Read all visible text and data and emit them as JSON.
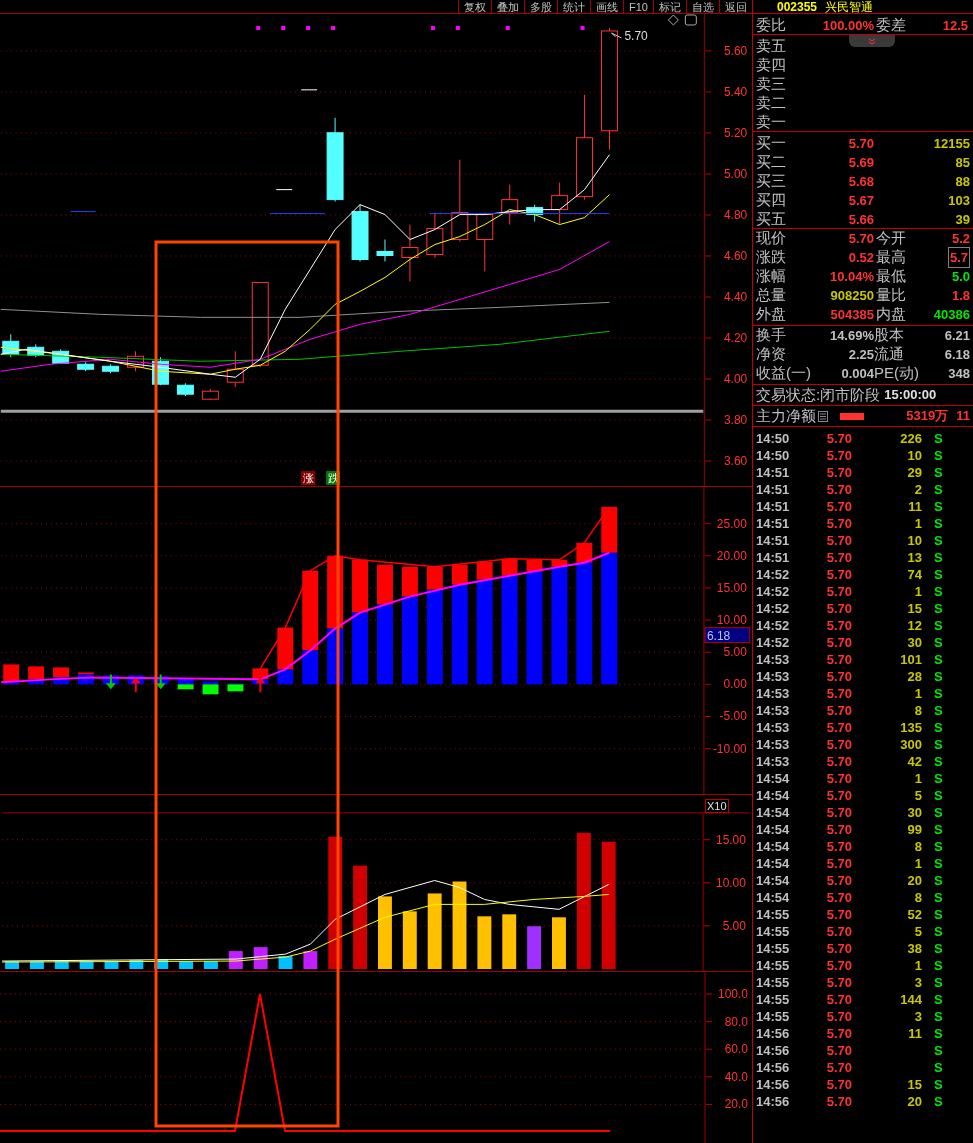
{
  "toolbar": {
    "buttons": [
      "复权",
      "叠加",
      "多股",
      "统计",
      "画线",
      "F10",
      "标记",
      "自选",
      "返回"
    ]
  },
  "price_chart": {
    "price_tag": "5.70",
    "yticks": [
      "5.60",
      "5.40",
      "5.20",
      "5.00",
      "4.80",
      "4.60",
      "4.40",
      "4.20",
      "4.00",
      "3.80",
      "3.60"
    ],
    "markers": [
      {
        "label": "涨",
        "color": "#8b0000"
      },
      {
        "label": "跌",
        "color": "#007a00"
      }
    ]
  },
  "indicator_chart": {
    "yticks": [
      "25.00",
      "20.00",
      "15.00",
      "10.00",
      "5.00",
      "0.00",
      "-5.00",
      "-10.00"
    ],
    "value_badge": "6.18"
  },
  "volume_chart": {
    "multiplier": "X10",
    "yticks": [
      "15.00",
      "10.00",
      "5.00"
    ]
  },
  "oscillator_chart": {
    "yticks": [
      "100.0",
      "80.0",
      "60.0",
      "40.0",
      "20.0"
    ]
  },
  "quote": {
    "code": "002355",
    "name": "兴民智通",
    "commission": [
      {
        "label": "委比",
        "value": "100.00%"
      },
      {
        "label": "委差",
        "value": "12.5"
      }
    ],
    "sell": [
      {
        "label": "卖五"
      },
      {
        "label": "卖四"
      },
      {
        "label": "卖三"
      },
      {
        "label": "卖二"
      },
      {
        "label": "卖一"
      }
    ],
    "buy": [
      {
        "label": "买一",
        "price": "5.70",
        "volume": "12155"
      },
      {
        "label": "买二",
        "price": "5.69",
        "volume": "85"
      },
      {
        "label": "买三",
        "price": "5.68",
        "volume": "88"
      },
      {
        "label": "买四",
        "price": "5.67",
        "volume": "103"
      },
      {
        "label": "买五",
        "price": "5.66",
        "volume": "39"
      }
    ],
    "stats": [
      {
        "label": "现价",
        "value": "5.70",
        "color": "#ff3232",
        "highlighted": false
      },
      {
        "label": "今开",
        "value": "5.2",
        "color": "#ff3232",
        "highlighted": false
      },
      {
        "label": "涨跌",
        "value": "0.52",
        "color": "#ff3232",
        "highlighted": false
      },
      {
        "label": "最高",
        "value": "5.7",
        "color": "#ff3232",
        "highlighted": true
      },
      {
        "label": "涨幅",
        "value": "10.04%",
        "color": "#ff3232",
        "highlighted": false
      },
      {
        "label": "最低",
        "value": "5.0",
        "color": "#00e600",
        "highlighted": false
      },
      {
        "label": "总量",
        "value": "908250",
        "color": "#c8c800",
        "highlighted": false
      },
      {
        "label": "量比",
        "value": "1.8",
        "color": "#ff3232",
        "highlighted": false
      },
      {
        "label": "外盘",
        "value": "504385",
        "color": "#ff3232",
        "highlighted": false
      },
      {
        "label": "内盘",
        "value": "40386",
        "color": "#00e600",
        "highlighted": false
      }
    ],
    "fundamentals": [
      {
        "label": "换手",
        "value": "14.69%"
      },
      {
        "label": "股本",
        "value": "6.21"
      },
      {
        "label": "净资",
        "value": "2.25"
      },
      {
        "label": "流通",
        "value": "6.18"
      },
      {
        "label": "收益(一)",
        "value": "0.004"
      },
      {
        "label": "PE(动)",
        "value": "348"
      }
    ],
    "trading_status": {
      "label": "交易状态:闭市阶段",
      "time": "15:00:00"
    },
    "main_net": {
      "label": "主力净额",
      "value": "5319万",
      "extra": "11"
    }
  },
  "trades": [
    {
      "time": "14:50",
      "price": "5.70",
      "volume": "226",
      "side": "S"
    },
    {
      "time": "14:50",
      "price": "5.70",
      "volume": "10",
      "side": "S"
    },
    {
      "time": "14:51",
      "price": "5.70",
      "volume": "29",
      "side": "S"
    },
    {
      "time": "14:51",
      "price": "5.70",
      "volume": "2",
      "side": "S"
    },
    {
      "time": "14:51",
      "price": "5.70",
      "volume": "11",
      "side": "S"
    },
    {
      "time": "14:51",
      "price": "5.70",
      "volume": "1",
      "side": "S"
    },
    {
      "time": "14:51",
      "price": "5.70",
      "volume": "10",
      "side": "S"
    },
    {
      "time": "14:51",
      "price": "5.70",
      "volume": "13",
      "side": "S"
    },
    {
      "time": "14:52",
      "price": "5.70",
      "volume": "74",
      "side": "S"
    },
    {
      "time": "14:52",
      "price": "5.70",
      "volume": "1",
      "side": "S"
    },
    {
      "time": "14:52",
      "price": "5.70",
      "volume": "15",
      "side": "S"
    },
    {
      "time": "14:52",
      "price": "5.70",
      "volume": "12",
      "side": "S"
    },
    {
      "time": "14:52",
      "price": "5.70",
      "volume": "30",
      "side": "S"
    },
    {
      "time": "14:53",
      "price": "5.70",
      "volume": "101",
      "side": "S"
    },
    {
      "time": "14:53",
      "price": "5.70",
      "volume": "28",
      "side": "S"
    },
    {
      "time": "14:53",
      "price": "5.70",
      "volume": "1",
      "side": "S"
    },
    {
      "time": "14:53",
      "price": "5.70",
      "volume": "8",
      "side": "S"
    },
    {
      "time": "14:53",
      "price": "5.70",
      "volume": "135",
      "side": "S"
    },
    {
      "time": "14:53",
      "price": "5.70",
      "volume": "300",
      "side": "S"
    },
    {
      "time": "14:53",
      "price": "5.70",
      "volume": "42",
      "side": "S"
    },
    {
      "time": "14:54",
      "price": "5.70",
      "volume": "1",
      "side": "S"
    },
    {
      "time": "14:54",
      "price": "5.70",
      "volume": "5",
      "side": "S"
    },
    {
      "time": "14:54",
      "price": "5.70",
      "volume": "30",
      "side": "S"
    },
    {
      "time": "14:54",
      "price": "5.70",
      "volume": "99",
      "side": "S"
    },
    {
      "time": "14:54",
      "price": "5.70",
      "volume": "8",
      "side": "S"
    },
    {
      "time": "14:54",
      "price": "5.70",
      "volume": "1",
      "side": "S"
    },
    {
      "time": "14:54",
      "price": "5.70",
      "volume": "20",
      "side": "S"
    },
    {
      "time": "14:54",
      "price": "5.70",
      "volume": "8",
      "side": "S"
    },
    {
      "time": "14:55",
      "price": "5.70",
      "volume": "52",
      "side": "S"
    },
    {
      "time": "14:55",
      "price": "5.70",
      "volume": "5",
      "side": "S"
    },
    {
      "time": "14:55",
      "price": "5.70",
      "volume": "38",
      "side": "S"
    },
    {
      "time": "14:55",
      "price": "5.70",
      "volume": "1",
      "side": "S"
    },
    {
      "time": "14:55",
      "price": "5.70",
      "volume": "3",
      "side": "S"
    },
    {
      "time": "14:55",
      "price": "5.70",
      "volume": "144",
      "side": "S"
    },
    {
      "time": "14:55",
      "price": "5.70",
      "volume": "3",
      "side": "S"
    },
    {
      "time": "14:56",
      "price": "5.70",
      "volume": "11",
      "side": "S"
    },
    {
      "time": "14:56",
      "price": "5.70",
      "side": "S"
    },
    {
      "time": "14:56",
      "price": "5.70",
      "side": "S"
    },
    {
      "time": "14:56",
      "price": "5.70",
      "volume": "15",
      "side": "S"
    },
    {
      "time": "14:56",
      "price": "5.70",
      "volume": "20",
      "side": "S"
    }
  ]
}
